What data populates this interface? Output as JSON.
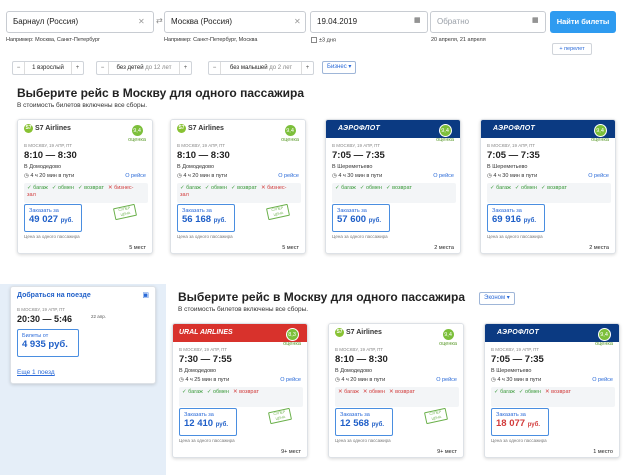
{
  "search": {
    "from": "Барнаул (Россия)",
    "to": "Москва (Россия)",
    "date": "19.04.2019",
    "return_placeholder": "Обратно",
    "from_hint": "Например: Москва, Санкт-Петербург",
    "to_hint": "Например: Санкт-Петербург, Москва",
    "plus3": "±3 дня",
    "return_hint": "20 апреля, 21 апреля",
    "find_label": "Найти билеты",
    "transfer_label": "+ перелет"
  },
  "passengers": [
    {
      "text": "1 взрослый",
      "extra": ""
    },
    {
      "text": "без детей",
      "extra": " до 12 лет"
    },
    {
      "text": "без малышей",
      "extra": " до 2 лет"
    }
  ],
  "class_select": "Бизнес ▾",
  "section1": {
    "title": "Выберите рейс в Москву для одного пассажира",
    "subtitle": "В стоимость билетов включены все сборы."
  },
  "section2": {
    "title": "Выберите рейс в Москву для одного пассажира",
    "subtitle": "В стоимость билетов включены все сборы.",
    "class_select": "Эконом ▾"
  },
  "train": {
    "title": "Добраться на поезде",
    "date": "В МОСКВУ, 19 АПР, ПТ",
    "time": "20:30 — 5:46",
    "arr_date": "22 апр.",
    "price_label": "Билеты от",
    "price": "4 935 руб.",
    "more": "Еще 1 поезд"
  },
  "cards": [
    {
      "airline": "S7 Airlines",
      "brand": "s7",
      "score": "9,4",
      "score_label": "оценка",
      "date": "В МОСКВУ, 19 АПР, ПТ",
      "time": "8:10 — 8:30",
      "airport": "В Домодедово",
      "dur": "4 ч 20 мин в пути",
      "more": "О рейсе",
      "features_ok": [
        "багаж",
        "обмен",
        "возврат"
      ],
      "features_no": [
        "бизнес-зал"
      ],
      "price_label": "Заказать за",
      "price": "49 027",
      "cur": "руб.",
      "red": false,
      "note": "Цена за одного пассажира",
      "seats": "5 мест",
      "stamp": "СУПЕР ЦЕНА"
    },
    {
      "airline": "S7 Airlines",
      "brand": "s7",
      "score": "9,4",
      "score_label": "оценка",
      "date": "В МОСКВУ, 19 АПР, ПТ",
      "time": "8:10 — 8:30",
      "airport": "В Домодедово",
      "dur": "4 ч 20 мин в пути",
      "more": "О рейсе",
      "features_ok": [
        "багаж",
        "обмен",
        "возврат"
      ],
      "features_no": [
        "бизнес-зал"
      ],
      "price_label": "Заказать за",
      "price": "56 168",
      "cur": "руб.",
      "red": false,
      "note": "Цена за одного пассажира",
      "seats": "5 мест",
      "stamp": "СУПЕР ЦЕНА"
    },
    {
      "airline": "АЭРОФЛОТ",
      "brand": "aero",
      "score": "9,4",
      "score_label": "оценка",
      "date": "В МОСКВУ, 19 АПР, ПТ",
      "time": "7:05 — 7:35",
      "airport": "В Шереметьево",
      "dur": "4 ч 30 мин в пути",
      "more": "О рейсе",
      "features_ok": [
        "багаж",
        "обмен",
        "возврат"
      ],
      "features_no": [],
      "price_label": "Заказать за",
      "price": "57 600",
      "cur": "руб.",
      "red": false,
      "note": "Цена за одного пассажира",
      "seats": "2 места",
      "stamp": ""
    },
    {
      "airline": "АЭРОФЛОТ",
      "brand": "aero",
      "score": "9,4",
      "score_label": "оценка",
      "date": "В МОСКВУ, 19 АПР, ПТ",
      "time": "7:05 — 7:35",
      "airport": "В Шереметьево",
      "dur": "4 ч 30 мин в пути",
      "more": "О рейсе",
      "features_ok": [
        "багаж",
        "обмен",
        "возврат"
      ],
      "features_no": [],
      "price_label": "Заказать за",
      "price": "69 916",
      "cur": "руб.",
      "red": false,
      "note": "Цена за одного пассажира",
      "seats": "2 места",
      "stamp": ""
    },
    {
      "airline": "URAL AIRLINES",
      "brand": "ural",
      "score": "8,3",
      "score_label": "оценка",
      "date": "В МОСКВУ, 19 АПР, ПТ",
      "time": "7:30 — 7:55",
      "airport": "В Домодедово",
      "dur": "4 ч 25 мин в пути",
      "more": "О рейсе",
      "features_ok": [
        "багаж",
        "обмен"
      ],
      "features_no": [
        "возврат"
      ],
      "price_label": "Заказать за",
      "price": "12 410",
      "cur": "руб.",
      "red": false,
      "note": "Цена за одного пассажира",
      "seats": "9+ мест",
      "stamp": "СУПЕР ЦЕНА"
    },
    {
      "airline": "S7 Airlines",
      "brand": "s7",
      "score": "9,4",
      "score_label": "оценка",
      "date": "В МОСКВУ, 19 АПР, ПТ",
      "time": "8:10 — 8:30",
      "airport": "В Домодедово",
      "dur": "4 ч 20 мин в пути",
      "more": "О рейсе",
      "features_ok": [],
      "features_no": [
        "багаж",
        "обмен",
        "возврат"
      ],
      "price_label": "Заказать за",
      "price": "12 568",
      "cur": "руб.",
      "red": false,
      "note": "Цена за одного пассажира",
      "seats": "9+ мест",
      "stamp": "СУПЕР ЦЕНА"
    },
    {
      "airline": "АЭРОФЛОТ",
      "brand": "aero",
      "score": "9,4",
      "score_label": "оценка",
      "date": "В МОСКВУ, 19 АПР, ПТ",
      "time": "7:05 — 7:35",
      "airport": "В Шереметьево",
      "dur": "4 ч 30 мин в пути",
      "more": "О рейсе",
      "features_ok": [
        "багаж",
        "обмен"
      ],
      "features_no": [
        "возврат"
      ],
      "price_label": "Заказать за",
      "price": "18 077",
      "cur": "руб.",
      "red": true,
      "note": "Цена за одного пассажира",
      "seats": "1 место",
      "stamp": ""
    }
  ]
}
